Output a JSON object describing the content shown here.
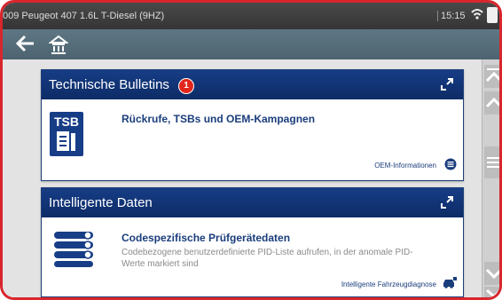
{
  "status_bar": {
    "vehicle": "009 Peugeot 407 1.6L T-Diesel (9HZ)",
    "time": "15:15"
  },
  "nav": {
    "back_icon": "back-arrow-icon",
    "home_icon": "home-icon"
  },
  "cards": [
    {
      "title": "Technische Bulletins",
      "badge": "1",
      "icon": "tsb-document-icon",
      "icon_label": "TSB",
      "headline": "Rückrufe, TSBs und OEM-Kampagnen",
      "link": "OEM-Informationen"
    },
    {
      "title": "Intelligente Daten",
      "icon": "data-stack-icon",
      "headline": "Codespezifische Prüfgerätedaten",
      "description": "Codebezogene benutzerdefinierte PID-Liste aufrufen, in der anomale PID-Werte markiert sind",
      "link": "Intelligente Fahrzeugdiagnose"
    }
  ],
  "colors": {
    "frame": "#d8262c",
    "header": "#173d86",
    "accent_text": "#1a3d7c",
    "badge": "#e2261c"
  }
}
